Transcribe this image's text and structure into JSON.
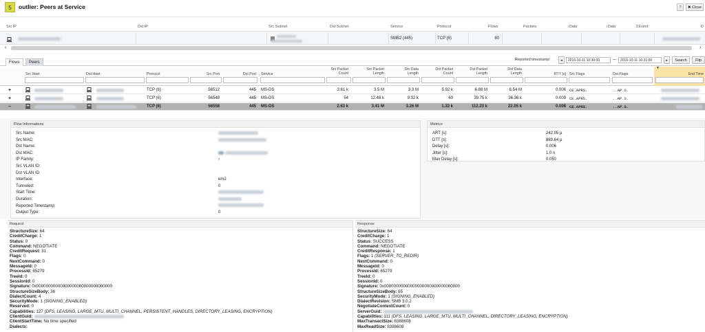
{
  "header": {
    "badge": "5",
    "title": "outlier: Peers at Service",
    "help": "?",
    "close": "✖ Close"
  },
  "grid": {
    "columns": [
      "Src IP",
      "Dst IP",
      "Src Subnet",
      "Dst Subnet",
      "Service",
      "Protocol",
      "Flows",
      "Packets",
      "↕Data",
      "↕Data",
      "ΣEvent",
      "D"
    ],
    "row": {
      "service": "SMB2 (445)",
      "protocol": "TCP (6)",
      "flows": "80"
    }
  },
  "tabs": [
    {
      "label": "Flows"
    },
    {
      "label": "Peers"
    }
  ],
  "timestamp": {
    "label": "Reported timestamp:",
    "from": "2016-10-11 10:30:00",
    "to": "2016-10-11 10:31:00",
    "search": "Search",
    "flip": "Flip",
    "sep": "—"
  },
  "flows": {
    "columns": {
      "src_host": "Src Host",
      "dst_host": "Dst Host",
      "protocol": "Protocol",
      "src_port": "Src Port",
      "dst_port": "Dst Port",
      "service": "Service",
      "src_pkt": "Src Packet Count",
      "src_pkt_len": "Src Packet Length",
      "src_data": "Src Data Length",
      "dst_pkt": "Dst Packet Count",
      "dst_pkt_len": "Dst Packet Length",
      "dst_data": "Dst Data Length",
      "rtt": "RTT [s]",
      "src_flags": "Src Flags",
      "dst_flags": "Dst Flags",
      "end_time": "End Time"
    },
    "rows": [
      {
        "toggle": "+",
        "protocol": "TCP (6)",
        "src_port": "56512",
        "dst_port": "445",
        "service": "MS-DS",
        "src_pkt": "3.61 k",
        "src_pkt_len": "3.5 M",
        "src_data": "3.3 M",
        "dst_pkt": "5.92 k",
        "dst_pkt_len": "6.88 M",
        "dst_data": "6.54 M",
        "rtt": "0.006",
        "src_flags": "CE.APRS.",
        "dst_flags": "..AP.S."
      },
      {
        "toggle": "+",
        "protocol": "TCP (6)",
        "src_port": "56548",
        "dst_port": "445",
        "service": "MS-DS",
        "src_pkt": "54",
        "src_pkt_len": "12.48 k",
        "src_data": "9.32 k",
        "dst_pkt": "60",
        "dst_pkt_len": "39.75 k",
        "dst_data": "36.36 k",
        "rtt": "0.009",
        "src_flags": "CE.APRS.",
        "dst_flags": "..AP.S."
      },
      {
        "toggle": "−",
        "protocol": "TCP (6)",
        "src_port": "56558",
        "dst_port": "445",
        "service": "MS-DS",
        "src_pkt": "2.63 k",
        "src_pkt_len": "3.41 M",
        "src_data": "3.26 M",
        "dst_pkt": "1.33 k",
        "dst_pkt_len": "112.23 k",
        "dst_data": "22.05 k",
        "rtt": "0.008",
        "src_flags": "CE.APRS.",
        "dst_flags": "..AP.S."
      }
    ]
  },
  "flow_info": {
    "title": "Flow Informations",
    "labels": [
      "Src Name:",
      "Src MAC:",
      "Dst Name:",
      "Dst MAC:",
      "IP Family:",
      "Src VLAN ID:",
      "Dst VLAN ID:",
      "Interface:",
      "Tunneled:",
      "Start Time:",
      "Duration:",
      "Reported Timestamp:",
      "Output Type:"
    ],
    "ip_family": "›",
    "interface": "em2",
    "tunneled": "0",
    "output_type": "0"
  },
  "metrics": {
    "title": "Metrics",
    "labels": [
      "ART [s]:",
      "DTT [s]:",
      "Delay [s]:",
      "Jitter [s]:",
      "Max Delay [s]:"
    ],
    "values": [
      "242.05 µ",
      "889.64 µ",
      "0.006",
      "1.0 n",
      "0.050"
    ]
  },
  "request": {
    "title": "Request",
    "lines": [
      {
        "k": "StructureSize:",
        "v": " 64"
      },
      {
        "k": "CreditCharge:",
        "v": " 1"
      },
      {
        "k": "Status:",
        "v": " 0"
      },
      {
        "k": "Command:",
        "v": " NEGOTIATE"
      },
      {
        "k": "CreditRequest:",
        "v": " 31"
      },
      {
        "k": "Flags:",
        "v": " 0"
      },
      {
        "k": "NextCommand:",
        "v": " 0"
      },
      {
        "k": "MessageId:",
        "v": " 0"
      },
      {
        "k": "ProcessId:",
        "v": " 65279"
      },
      {
        "k": "TreeId:",
        "v": " 0"
      },
      {
        "k": "SessionId:",
        "v": " 0"
      },
      {
        "k": "Signature:",
        "v": " 0x00000000000000000000000000000000"
      },
      {
        "k": "StructureSizeBody:",
        "v": " 36"
      },
      {
        "k": "DialectCount:",
        "v": " 4"
      },
      {
        "k": "SecurityMode:",
        "v": " 1 ",
        "it": "(SIGNING_ENABLED)"
      },
      {
        "k": "Reserved:",
        "v": " 0"
      },
      {
        "k": "Capabilities:",
        "v": " 127 ",
        "it": "(DFS, LEASING, LARGE_MTU, MULTI_CHANNEL, PERSISTENT_HANDLES, DIRECTORY_LEASING, ENCRYPTION)"
      },
      {
        "k": "ClientGuid:",
        "v": ""
      },
      {
        "k": "ClientStartTime:",
        "v": " No time specified"
      },
      {
        "k": "Dialects:",
        "v": ""
      }
    ]
  },
  "response": {
    "title": "Response",
    "lines": [
      {
        "k": "StructureSize:",
        "v": " 64"
      },
      {
        "k": "CreditCharge:",
        "v": " 1"
      },
      {
        "k": "Status:",
        "v": " SUCCESS"
      },
      {
        "k": "Command:",
        "v": " NEGOTIATE"
      },
      {
        "k": "CreditResponse:",
        "v": " 1"
      },
      {
        "k": "Flags:",
        "v": " 1 ",
        "it": "(SERVER_TO_REDIR)"
      },
      {
        "k": "NextCommand:",
        "v": " 0"
      },
      {
        "k": "MessageId:",
        "v": " 0"
      },
      {
        "k": "ProcessId:",
        "v": " 65279"
      },
      {
        "k": "TreeId:",
        "v": " 0"
      },
      {
        "k": "SessionId:",
        "v": " 0"
      },
      {
        "k": "Signature:",
        "v": " 0x00000000000000000000000000000000"
      },
      {
        "k": "StructureSizeBody:",
        "v": " 65"
      },
      {
        "k": "SecurityMode:",
        "v": " 1 ",
        "it": "(SIGNING_ENABLED)"
      },
      {
        "k": "DialectRevision:",
        "v": " SMB 3.0.2"
      },
      {
        "k": "NegotiateContextCount:",
        "v": " 0"
      },
      {
        "k": "ServerGuid:",
        "v": ""
      },
      {
        "k": "Capabilities:",
        "v": " 111 ",
        "it": "(DFS, LEASING, LARGE_MTU, MULTI_CHANNEL, DIRECTORY_LEASING, ENCRYPTION)"
      },
      {
        "k": "MaxTransactSize:",
        "v": " 8388608"
      },
      {
        "k": "MaxReadSize:",
        "v": " 8388608"
      }
    ]
  },
  "colors": {
    "badge": "#d8d84a",
    "selected_row": "#b2b2b2",
    "end_time_header": "#fbe3a6"
  }
}
